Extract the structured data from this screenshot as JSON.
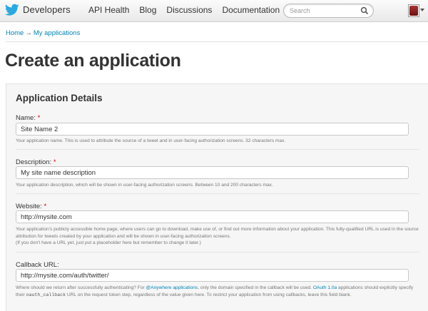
{
  "topbar": {
    "brand": "Developers",
    "nav": [
      "API Health",
      "Blog",
      "Discussions",
      "Documentation"
    ],
    "search_placeholder": "Search"
  },
  "breadcrumb": {
    "home": "Home",
    "sep": "→",
    "current": "My applications"
  },
  "page_title": "Create an application",
  "panel": {
    "title": "Application Details",
    "name": {
      "label": "Name:",
      "required": "*",
      "value": "Site Name 2",
      "help": "Your application name. This is used to attribute the source of a tweet and in user-facing authorization screens. 32 characters max."
    },
    "description": {
      "label": "Description:",
      "required": "*",
      "value": "My site name description",
      "help": "Your application description, which will be shown in user-facing authorization screens. Between 10 and 200 characters max."
    },
    "website": {
      "label": "Website:",
      "required": "*",
      "value": "http://mysite.com",
      "help_line1": "Your application's publicly accessible home page, where users can go to download, make use of, or find out more information about your application. This fully-qualified URL is used in the source attribution for tweets created by your application and will be shown in user-facing authorization screens.",
      "help_line2": "(If you don't have a URL yet, just put a placeholder here but remember to change it later.)"
    },
    "callback": {
      "label": "Callback URL:",
      "value": "http://mysite.com/auth/twitter/",
      "help_a": "Where should we return after successfully authenticating? For ",
      "help_link1": "@Anywhere applications",
      "help_b": ", only the domain specified in the callback will be used. ",
      "help_link2": "OAuth 1.0a",
      "help_c": " applications should explicitly specify their ",
      "help_code": "oauth_callback",
      "help_d": " URL on the request token step, regardless of the value given here. To restrict your application from using callbacks, leave this field blank."
    }
  }
}
